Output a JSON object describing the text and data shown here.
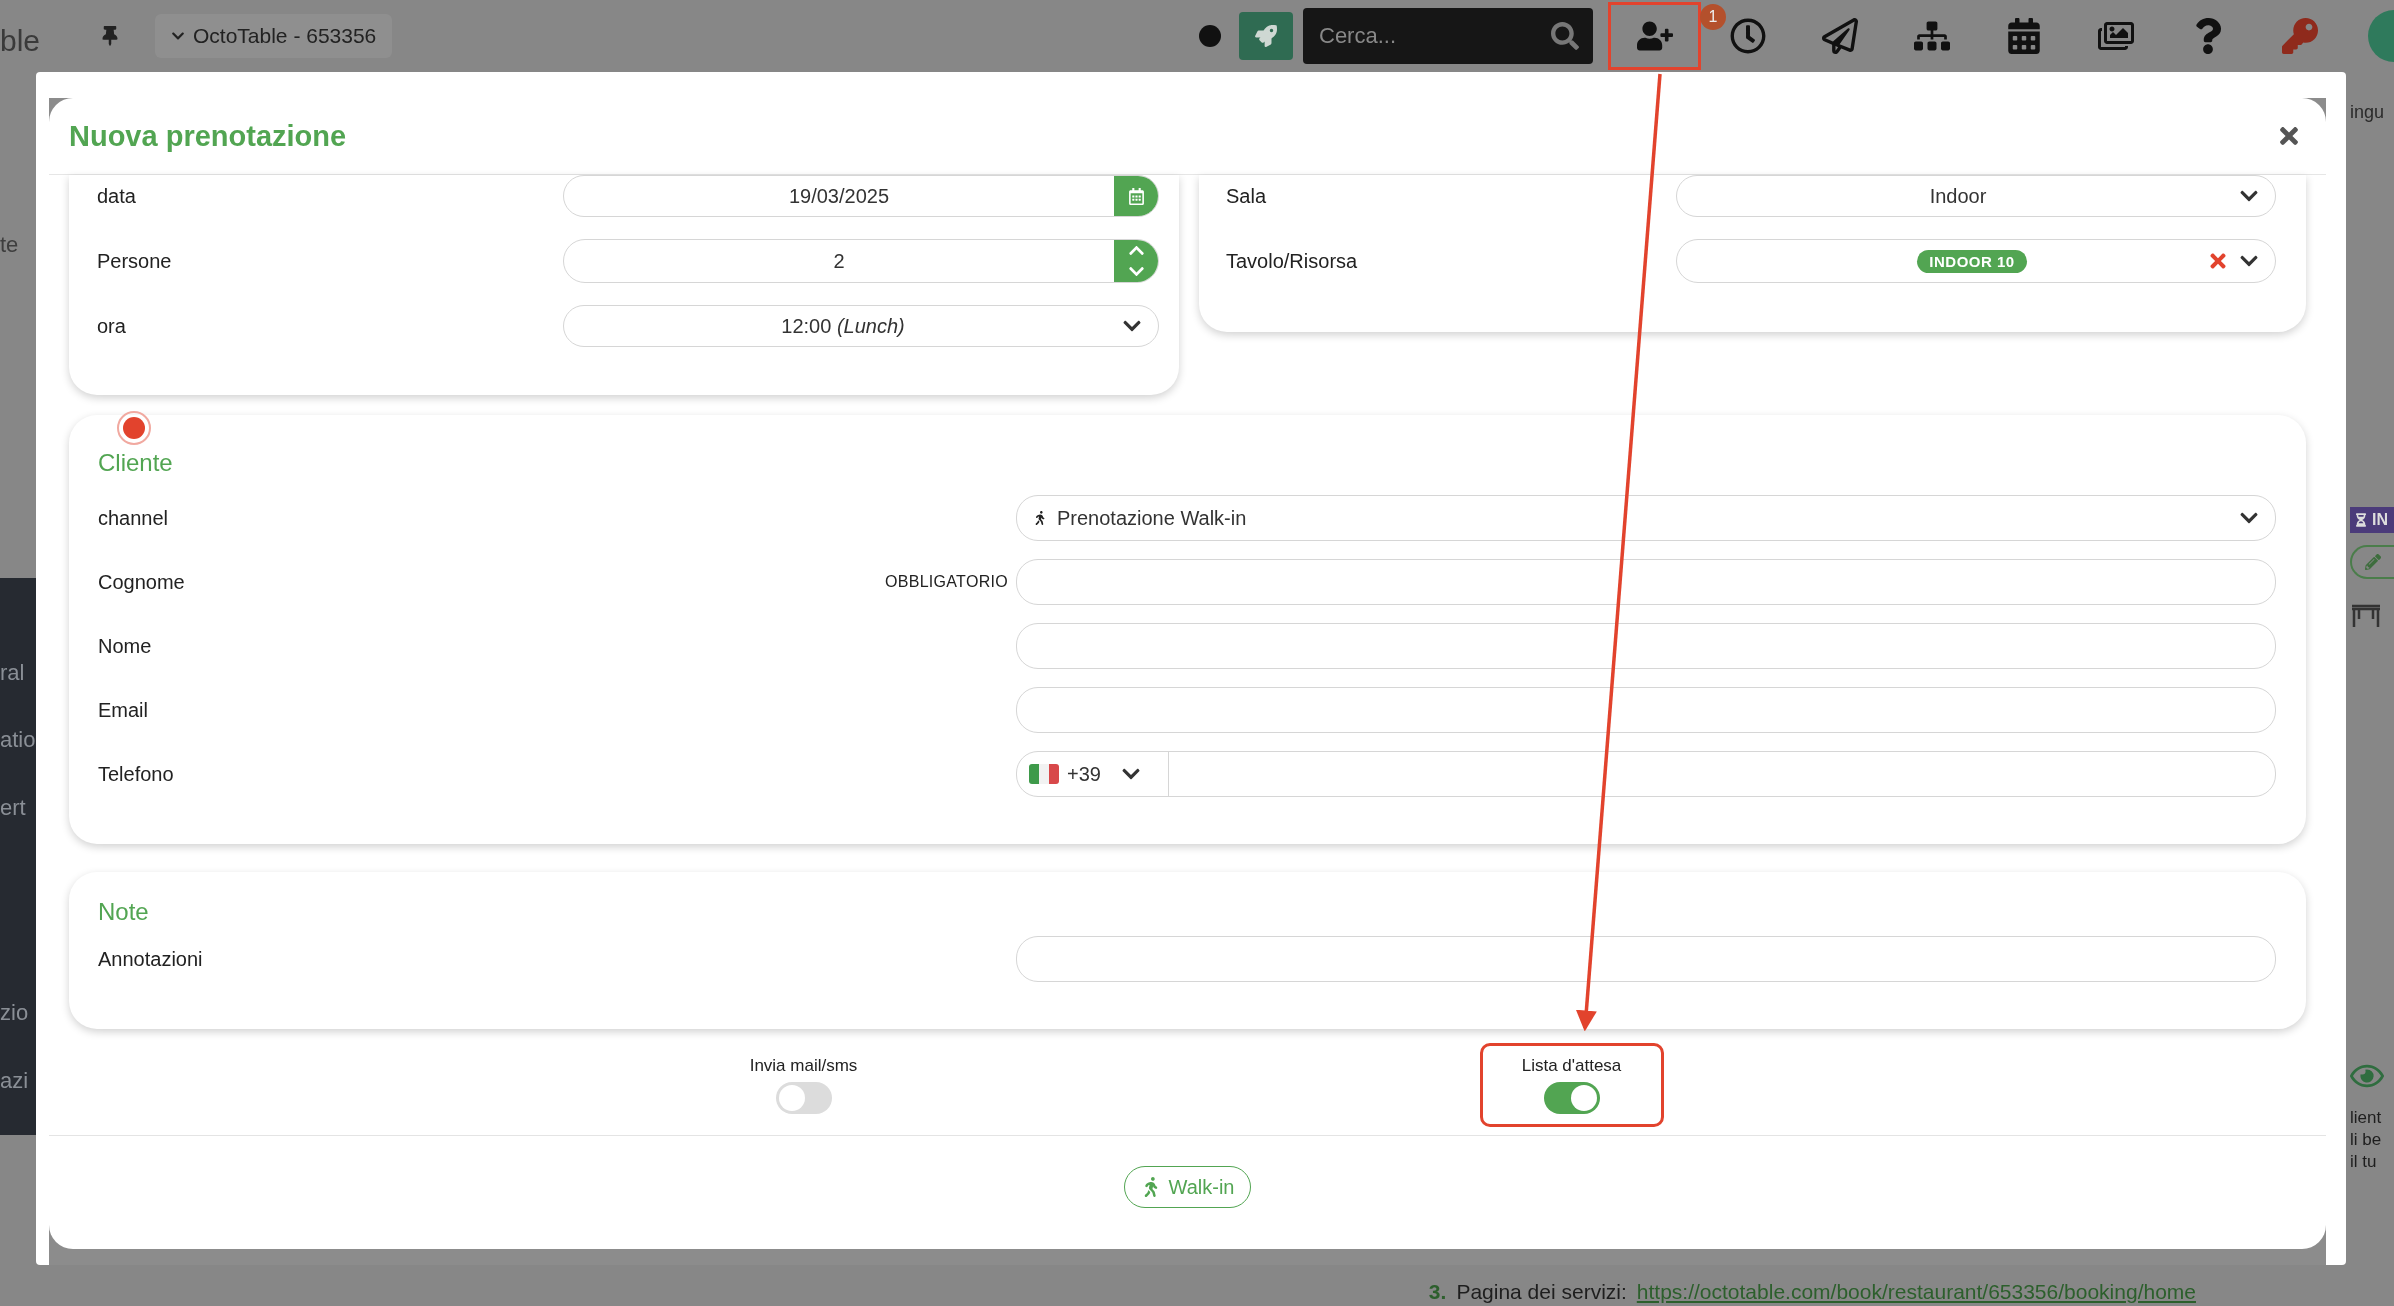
{
  "app": {
    "title_fragment": "ble",
    "restaurant_selector": "OctoTable - 653356",
    "search": {
      "placeholder": "Cerca..."
    },
    "toolbar": [
      {
        "kind": "add-user",
        "highlighted": true,
        "badge": "1"
      },
      {
        "kind": "clock",
        "highlighted": false
      },
      {
        "kind": "send",
        "highlighted": false
      },
      {
        "kind": "sitemap",
        "highlighted": false
      },
      {
        "kind": "calendar",
        "highlighted": false
      },
      {
        "kind": "images",
        "highlighted": false
      },
      {
        "kind": "help",
        "highlighted": false
      },
      {
        "kind": "key",
        "highlighted": false
      }
    ]
  },
  "sidebar": {
    "header_fragment": "te",
    "items": [
      "ral",
      "atio",
      "ert",
      "zio",
      "azi"
    ]
  },
  "right_panel": {
    "heading_fragment": "ingu",
    "status_tag": "IN",
    "text_lines": [
      "lient",
      "li be",
      "il tu"
    ]
  },
  "background_list": {
    "number": "3.",
    "label": "Pagina dei servizi:",
    "link": "https://octotable.com/book/restaurant/653356/booking/home"
  },
  "modal": {
    "title": "Nuova prenotazione",
    "booking": [
      {
        "label": "data",
        "kind": "date",
        "value": "19/03/2025"
      },
      {
        "label": "Persone",
        "kind": "number",
        "value": "2"
      },
      {
        "label": "ora",
        "kind": "select",
        "value": "12:00 *(Lunch)*"
      }
    ],
    "placement": [
      {
        "label": "Sala",
        "kind": "select",
        "value": "Indoor"
      },
      {
        "label": "Tavolo/Risorsa",
        "kind": "tags",
        "value": "INDOOR 10"
      }
    ],
    "cliente": {
      "title": "Cliente",
      "fields": [
        {
          "label": "channel",
          "kind": "select",
          "value": "Prenotazione Walk-in"
        },
        {
          "label": "Cognome",
          "kind": "text",
          "required_note": "OBBLIGATORIO"
        },
        {
          "label": "Nome",
          "kind": "text"
        },
        {
          "label": "Email",
          "kind": "text"
        },
        {
          "label": "Telefono",
          "kind": "phone",
          "prefix": "+39"
        }
      ]
    },
    "note": {
      "title": "Note",
      "fields": [
        {
          "label": "Annotazioni",
          "kind": "text"
        }
      ]
    },
    "toggles": [
      {
        "label": "Invia mail/sms",
        "on": false,
        "highlighted": false
      },
      {
        "label": "Lista d'attesa",
        "on": true,
        "highlighted": true
      }
    ],
    "action": "Walk-in"
  }
}
